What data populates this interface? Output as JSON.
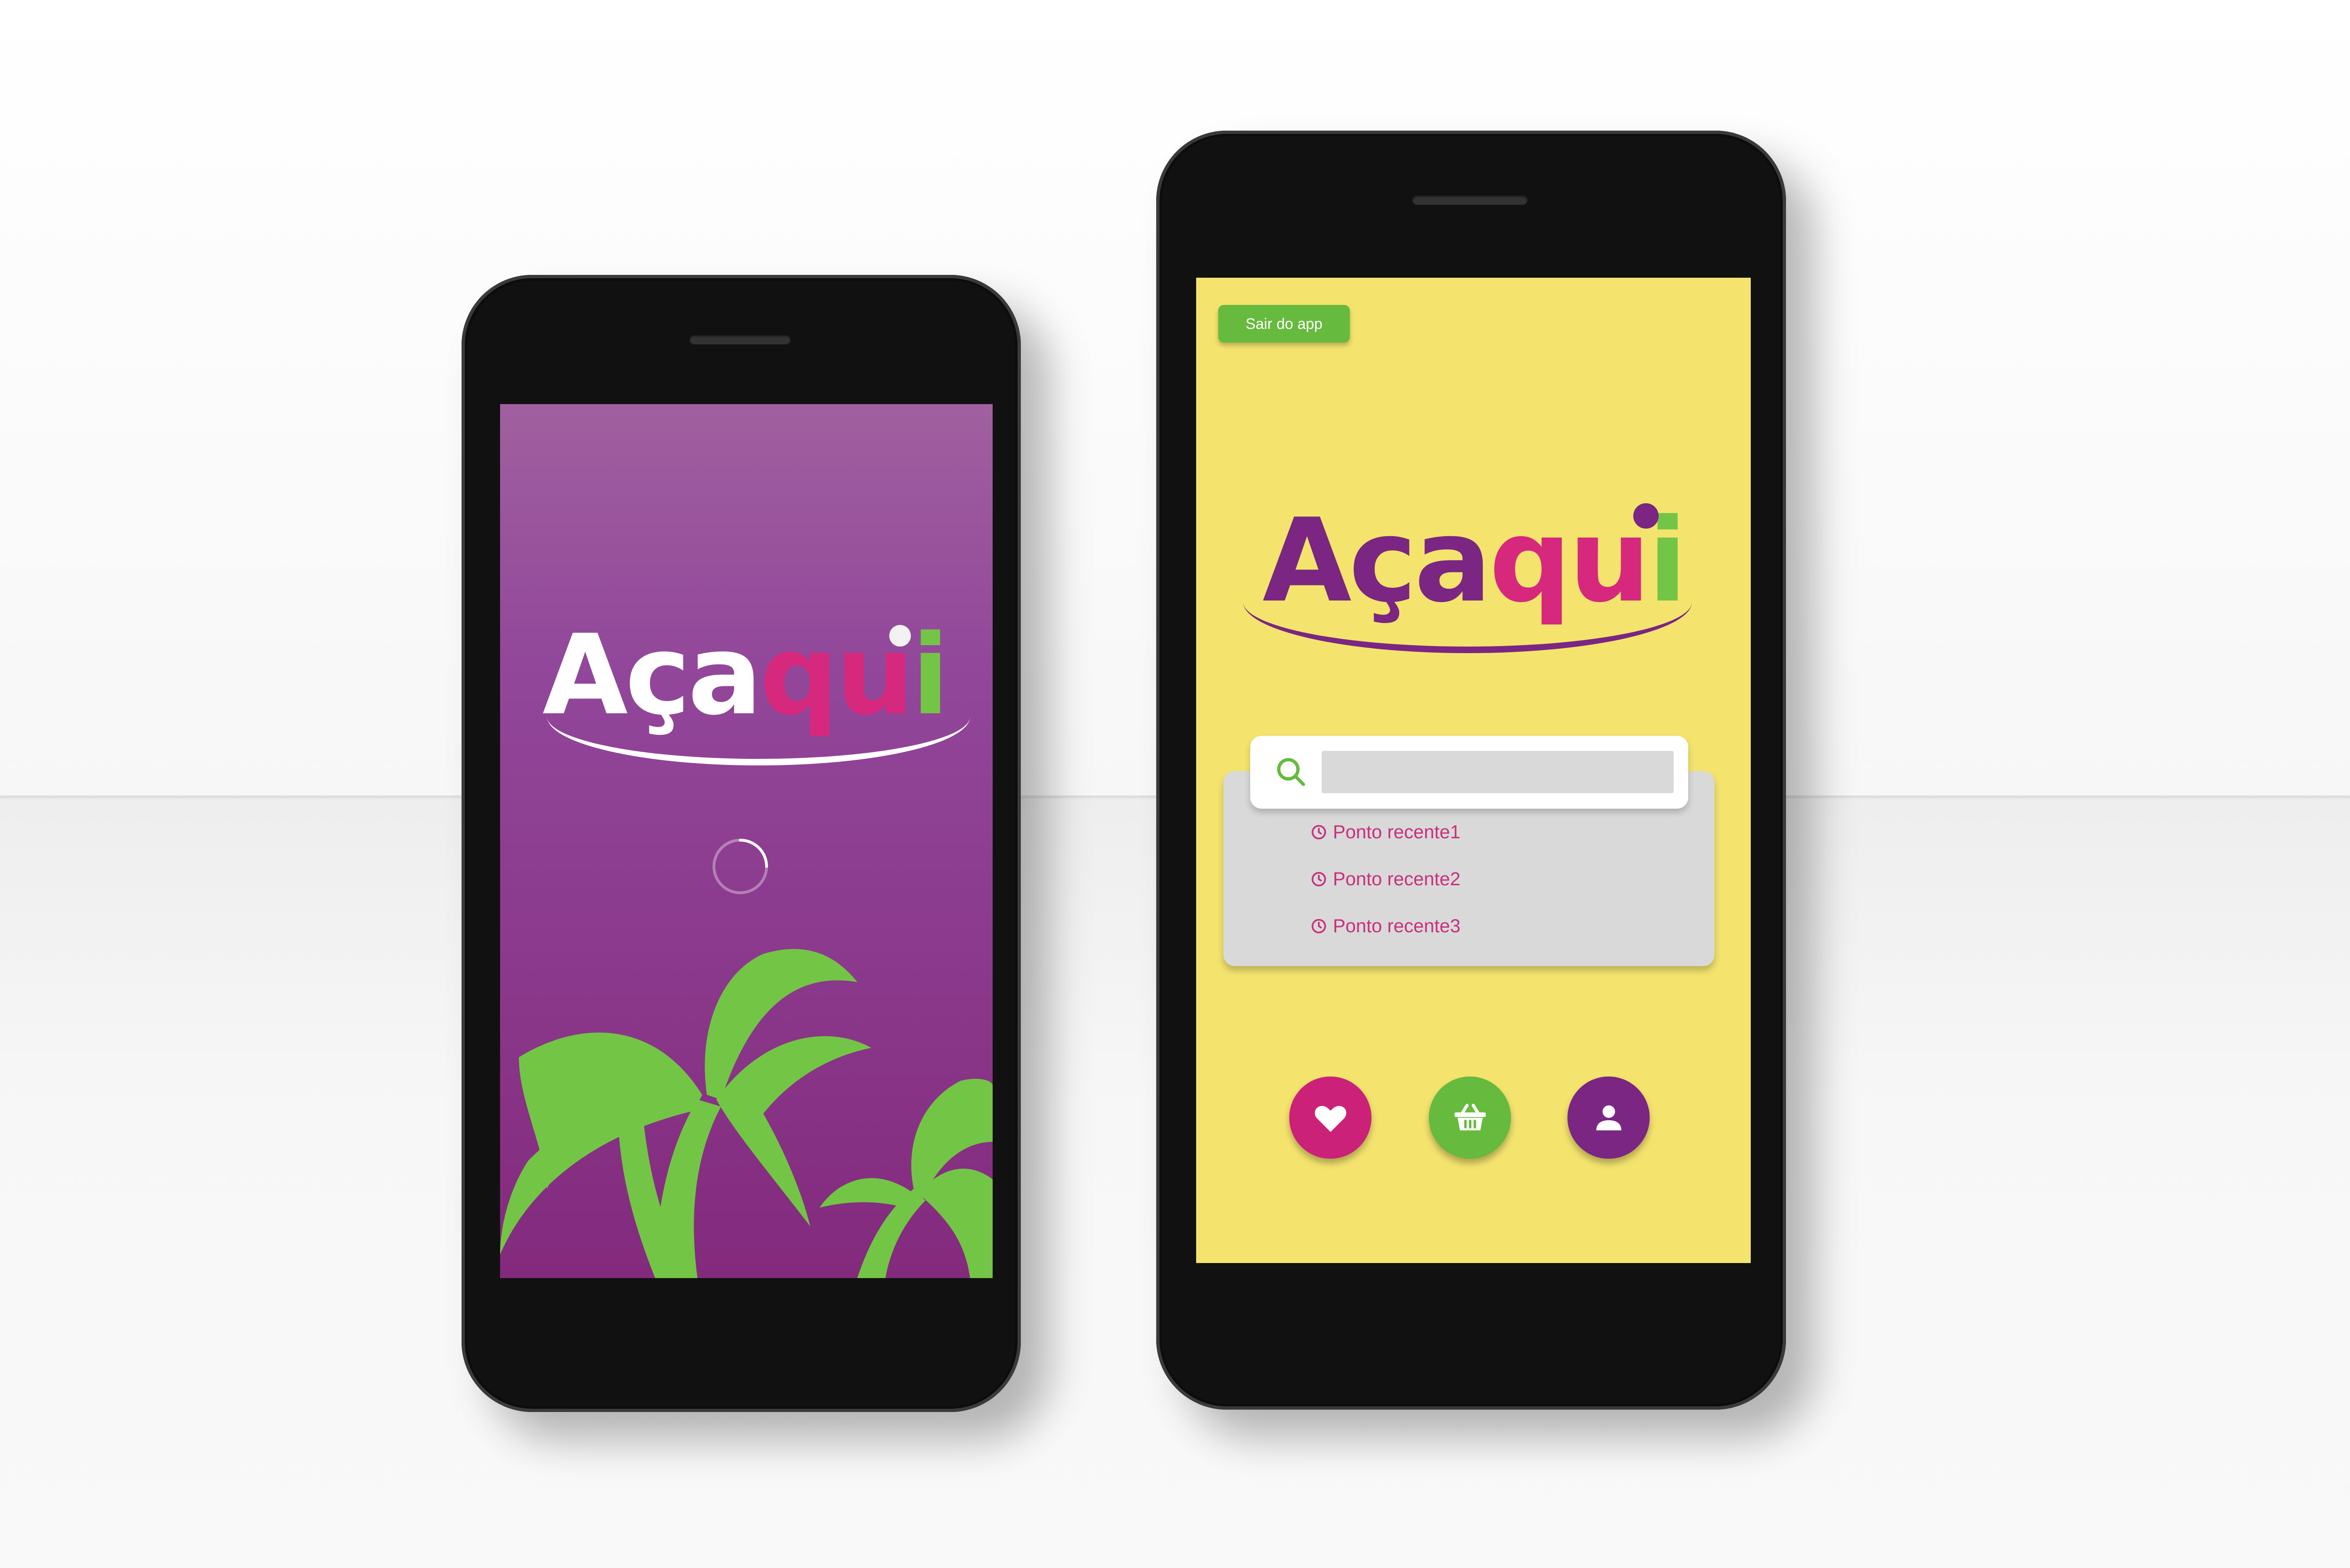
{
  "brand": {
    "word_part1": "Aça",
    "word_part2": "qu",
    "word_part3": "i",
    "colors": {
      "purple": "#7a2682",
      "pink": "#d6287d",
      "green": "#73c545",
      "yellow": "#f4e46e",
      "white": "#ffffff"
    }
  },
  "splash_screen": {
    "background": "#92479a",
    "loading_indicator": "spinner-icon",
    "decoration": "palm-trees"
  },
  "home_screen": {
    "exit_button_label": "Sair do app",
    "search": {
      "icon": "search-icon",
      "value": "",
      "placeholder": ""
    },
    "recent_items": [
      {
        "label": "Ponto recente1",
        "icon": "clock-icon"
      },
      {
        "label": "Ponto recente2",
        "icon": "clock-icon"
      },
      {
        "label": "Ponto recente3",
        "icon": "clock-icon"
      }
    ],
    "nav_buttons": [
      {
        "icon": "heart-icon",
        "color": "#cb2178"
      },
      {
        "icon": "basket-icon",
        "color": "#66ba3e"
      },
      {
        "icon": "user-icon",
        "color": "#7a2682"
      }
    ]
  }
}
